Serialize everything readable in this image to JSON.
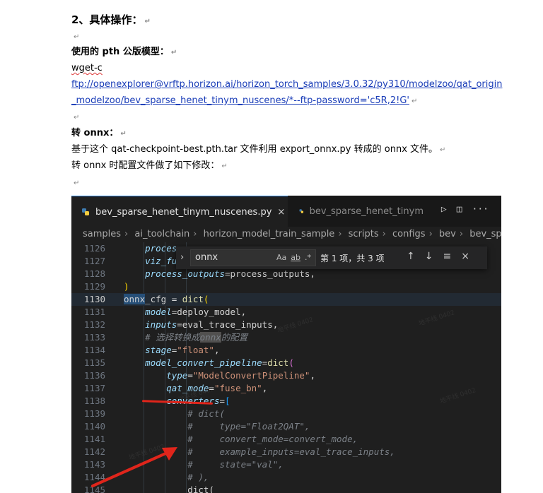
{
  "doc": {
    "heading": "2、具体操作：",
    "pth_label": "使用的 pth 公版模型：",
    "wget": "wget-c",
    "link_line1": "ftp://openexplorer@vrftp.horizon.ai/horizon_torch_samples/3.0.32/py310/modelzoo/qat_origin",
    "link_line2": "_modelzoo/bev_sparse_henet_tinym_nuscenes/*--ftp-password='c5R,2!G'",
    "onnx_label": "转 onnx：",
    "para1": "基于这个 qat-checkpoint-best.pth.tar 文件利用 export_onnx.py 转成的 onnx 文件。",
    "para2": "转 onnx 时配置文件做了如下修改：",
    "para_mark": "↵"
  },
  "editor": {
    "tab_active": "bev_sparse_henet_tinym_nuscenes.py",
    "tab_close": "×",
    "tab_inactive": "bev_sparse_henet_tinym",
    "breadcrumbs": [
      "samples",
      "ai_toolchain",
      "horizon_model_train_sample",
      "scripts",
      "configs",
      "bev",
      "bev_spa"
    ],
    "find": {
      "query": "onnx",
      "result": "第 1 项，共 3 项",
      "opt_case": "Aa",
      "opt_word": "ab",
      "opt_regex": ".*"
    },
    "lines": [
      {
        "n": "1126",
        "t": "        process"
      },
      {
        "n": "1127",
        "t": "        viz_fu"
      },
      {
        "n": "1128",
        "t": "        process_outputs=process_outputs,"
      },
      {
        "n": "1129",
        "t": "    )"
      },
      {
        "n": "1130",
        "t": "onnx_cfg = dict("
      },
      {
        "n": "1131",
        "t": "    model=deploy_model,"
      },
      {
        "n": "1132",
        "t": "    inputs=eval_trace_inputs,"
      },
      {
        "n": "1133",
        "t": "    # 选择转换成onnx的配置"
      },
      {
        "n": "1134",
        "t": "    stage=\"float\","
      },
      {
        "n": "1135",
        "t": "    model_convert_pipeline=dict("
      },
      {
        "n": "1136",
        "t": "        type=\"ModelConvertPipeline\","
      },
      {
        "n": "1137",
        "t": "        qat_mode=\"fuse_bn\","
      },
      {
        "n": "1138",
        "t": "        converters=["
      },
      {
        "n": "1139",
        "t": "            # dict("
      },
      {
        "n": "1140",
        "t": "            #     type=\"Float2QAT\","
      },
      {
        "n": "1141",
        "t": "            #     convert_mode=convert_mode,"
      },
      {
        "n": "1142",
        "t": "            #     example_inputs=eval_trace_inputs,"
      },
      {
        "n": "1143",
        "t": "            #     state=\"val\","
      },
      {
        "n": "1144",
        "t": "            # ),"
      },
      {
        "n": "1145",
        "t": "            dict("
      }
    ]
  },
  "colors": {
    "accent_red": "#e0251b",
    "link_blue": "#1a3db8",
    "editor_bg": "#1f1f1f"
  }
}
